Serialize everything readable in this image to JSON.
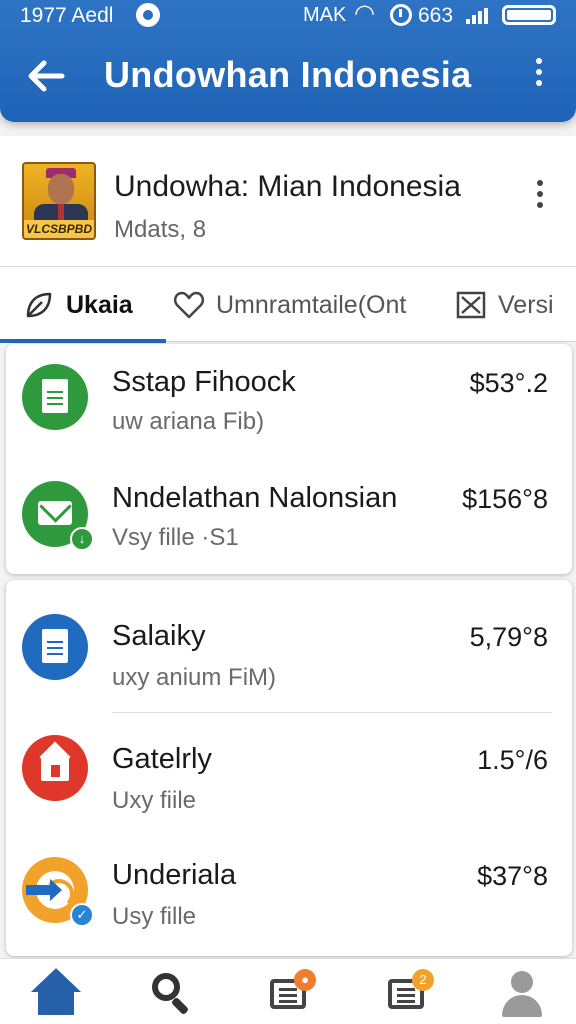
{
  "status_bar": {
    "time": "1977 Aedl",
    "carrier": "MAK",
    "battery_text": "663"
  },
  "app_bar": {
    "title": "Undowhan Indonesia",
    "back_icon": "arrow-left-icon",
    "menu_icon": "more-vertical-icon"
  },
  "profile": {
    "name": "Undowha: Mian Indonesia",
    "subtitle": "Mdats, 8",
    "avatar_tag": "VLCSBPBD"
  },
  "tabs": [
    {
      "label": "Ukaia",
      "icon": "leaf-icon",
      "active": true
    },
    {
      "label": "Umnramtaile(Ont",
      "icon": "heart-icon",
      "active": false
    },
    {
      "label": "Versi",
      "icon": "close-box-icon",
      "active": false
    }
  ],
  "group_1": [
    {
      "title": "Sstap Fihoock",
      "subtitle": "uw ariana Fib)",
      "amount": "$53°.2",
      "icon": "document-icon",
      "color": "#2f9a3d"
    },
    {
      "title": "Nndelathan Nalonsian",
      "subtitle": "Vsy fille ·S1",
      "amount": "$156°8",
      "icon": "mail-icon",
      "color": "#2f9a3d"
    }
  ],
  "group_2": [
    {
      "title": "Salaiky",
      "subtitle": "uxy anium FiM)",
      "amount": "5,79°8",
      "icon": "document-icon",
      "color": "#1e6bbf"
    },
    {
      "title": "Gatelrly",
      "subtitle": "Uxy fiile",
      "amount": "1.5°/6",
      "icon": "home-icon",
      "color": "#e0372b"
    },
    {
      "title": "Underiala",
      "subtitle": "Usy fille",
      "amount": "$37°8",
      "icon": "rss-icon",
      "color": "#f2a22a"
    }
  ],
  "bottom_nav": [
    {
      "name": "home",
      "icon": "home-icon"
    },
    {
      "name": "search",
      "icon": "search-icon"
    },
    {
      "name": "messages",
      "icon": "inbox-icon",
      "badge": ""
    },
    {
      "name": "notifications",
      "icon": "inbox-icon",
      "badge": "2"
    },
    {
      "name": "profile",
      "icon": "person-icon"
    }
  ]
}
